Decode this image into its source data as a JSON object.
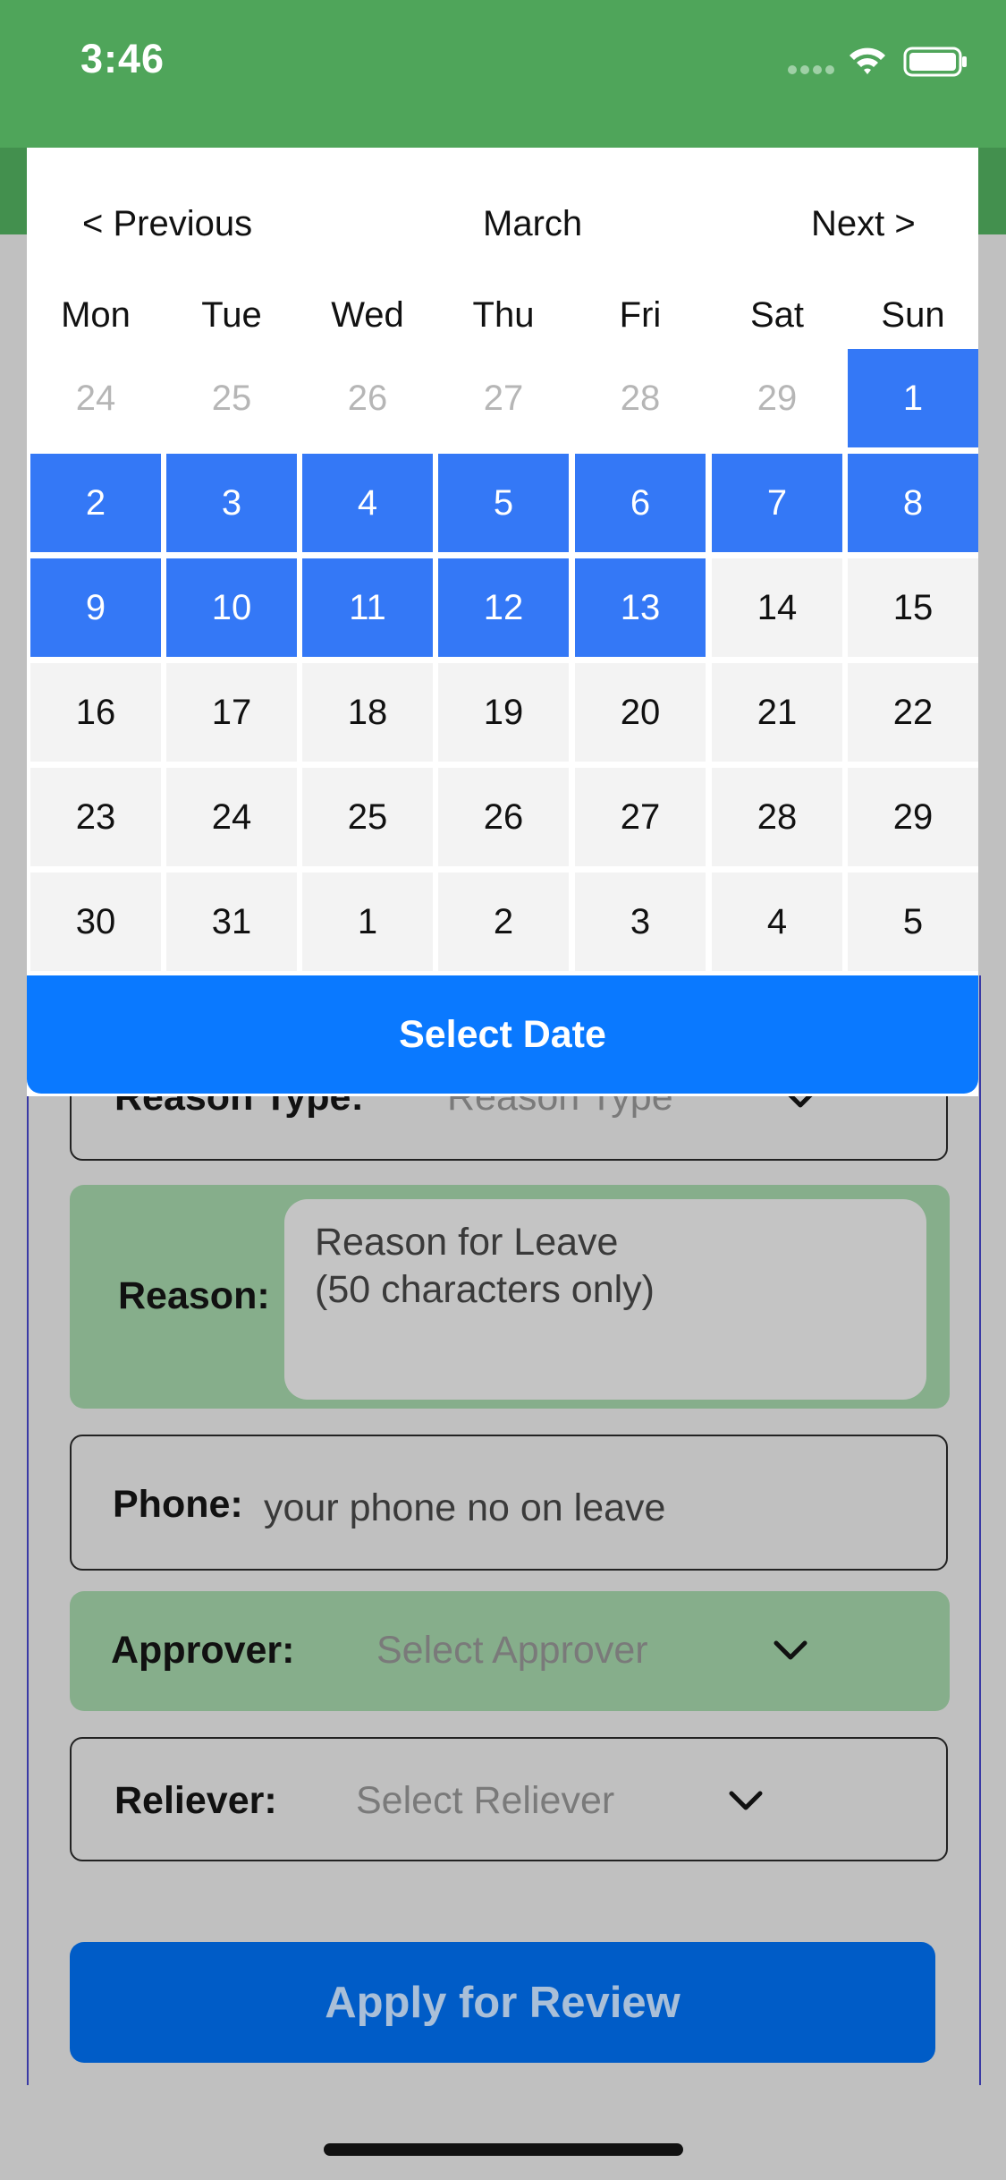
{
  "status_bar": {
    "time": "3:46"
  },
  "calendar": {
    "prev_label": "< Previous",
    "month": "March",
    "next_label": "Next >",
    "weekdays": [
      "Mon",
      "Tue",
      "Wed",
      "Thu",
      "Fri",
      "Sat",
      "Sun"
    ],
    "rows": [
      [
        "24",
        "25",
        "26",
        "27",
        "28",
        "29",
        "1"
      ],
      [
        "2",
        "3",
        "4",
        "5",
        "6",
        "7",
        "8"
      ],
      [
        "9",
        "10",
        "11",
        "12",
        "13",
        "14",
        "15"
      ],
      [
        "16",
        "17",
        "18",
        "19",
        "20",
        "21",
        "22"
      ],
      [
        "23",
        "24",
        "25",
        "26",
        "27",
        "28",
        "29"
      ],
      [
        "30",
        "31",
        "1",
        "2",
        "3",
        "4",
        "5"
      ]
    ],
    "select_label": "Select Date",
    "colors": {
      "selected": "#3478f6",
      "button": "#0a79ff"
    }
  },
  "form": {
    "reason_type_label": "Reason Type:",
    "reason_type_placeholder": "Reason Type",
    "reason_label": "Reason:",
    "reason_placeholder_line1": "Reason for Leave",
    "reason_placeholder_line2": "(50 characters only)",
    "phone_label": "Phone:",
    "phone_placeholder": "your phone no on leave",
    "approver_label": "Approver:",
    "approver_placeholder": "Select Approver",
    "reliever_label": "Reliever:",
    "reliever_placeholder": "Select Reliever",
    "apply_label": "Apply for Review",
    "colors": {
      "header": "#4fa55a",
      "apply": "#005cc7"
    }
  }
}
